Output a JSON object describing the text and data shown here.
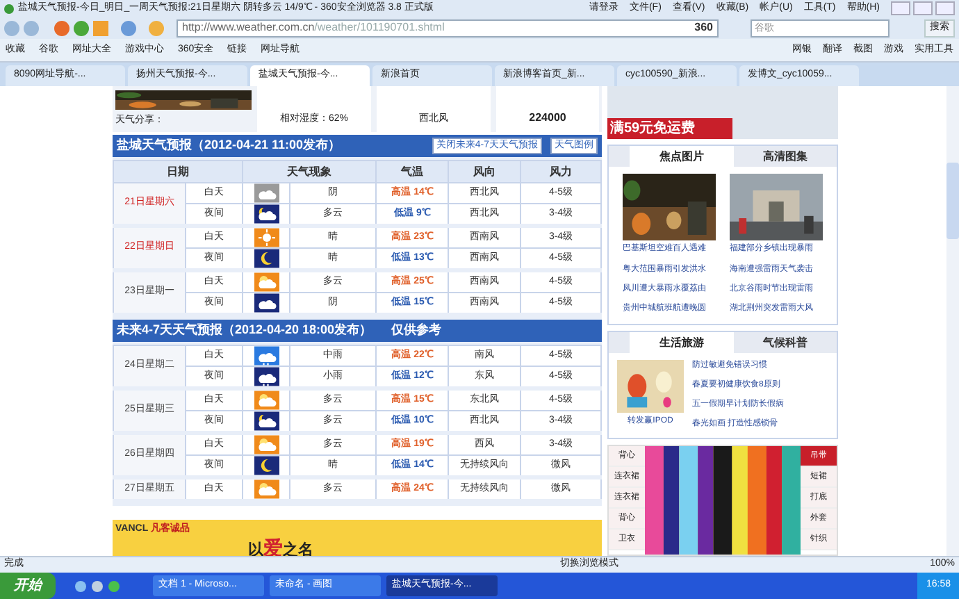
{
  "window": {
    "title": "盐城天气预报-今日_明日_一周天气预报:21日星期六 阴转多云 14/9℃ - 360安全浏览器 3.8 正式版"
  },
  "menu": [
    "请登录",
    "文件(F)",
    "查看(V)",
    "收藏(B)",
    "帐户(U)",
    "工具(T)",
    "帮助(H)"
  ],
  "address": {
    "host": "http://www.weather.com.cn",
    "path": "/weather/101190701.shtml"
  },
  "brand": "360",
  "search": {
    "placeholder": "谷歌",
    "button": "搜索"
  },
  "bookmarks": [
    "收藏",
    "谷歌",
    "网址大全",
    "游戏中心",
    "360安全",
    "链接",
    "网址导航"
  ],
  "tools": [
    "网银",
    "翻译",
    "截图",
    "游戏",
    "实用工具"
  ],
  "tabs": [
    {
      "label": "8090网址导航-...",
      "selected": false
    },
    {
      "label": "扬州天气预报-今...",
      "selected": false
    },
    {
      "label": "盐城天气预报-今...",
      "selected": true
    },
    {
      "label": "新浪首页",
      "selected": false
    },
    {
      "label": "新浪博客首页_新...",
      "selected": false
    },
    {
      "label": "cyc100590_新浪...",
      "selected": false
    },
    {
      "label": "发博文_cyc10059...",
      "selected": false
    }
  ],
  "top_strip": {
    "share": "天气分享：",
    "humidity": "相对湿度：62%",
    "wind": "西北风",
    "count": "224000"
  },
  "forecasts": [
    {
      "title": "盐城天气预报（2012-04-21 11:00发布）",
      "buttons": [
        "关闭未来4-7天天气预报",
        "天气图例"
      ],
      "columns": [
        "日期",
        "天气现象",
        "气温",
        "风向",
        "风力"
      ],
      "days": [
        {
          "date": "21日星期六",
          "weekend": true,
          "periods": [
            {
              "period": "白天",
              "kind": "overcast-day",
              "weather": "阴",
              "temp": {
                "kind": "high",
                "text": "高温 14℃"
              },
              "wind_dir": "西北风",
              "wind_force": "4-5级"
            },
            {
              "period": "夜间",
              "kind": "cloud-night",
              "weather": "多云",
              "temp": {
                "kind": "low",
                "text": "低温 9℃"
              },
              "wind_dir": "西北风",
              "wind_force": "3-4级"
            }
          ]
        },
        {
          "date": "22日星期日",
          "weekend": true,
          "periods": [
            {
              "period": "白天",
              "kind": "sun",
              "weather": "晴",
              "temp": {
                "kind": "high",
                "text": "高温 23℃"
              },
              "wind_dir": "西南风",
              "wind_force": "3-4级"
            },
            {
              "period": "夜间",
              "kind": "moon",
              "weather": "晴",
              "temp": {
                "kind": "low",
                "text": "低温 13℃"
              },
              "wind_dir": "西南风",
              "wind_force": "4-5级"
            }
          ]
        },
        {
          "date": "23日星期一",
          "weekend": false,
          "periods": [
            {
              "period": "白天",
              "kind": "cloud-day",
              "weather": "多云",
              "temp": {
                "kind": "high",
                "text": "高温 25℃"
              },
              "wind_dir": "西南风",
              "wind_force": "4-5级"
            },
            {
              "period": "夜间",
              "kind": "overcast-night",
              "weather": "阴",
              "temp": {
                "kind": "low",
                "text": "低温 15℃"
              },
              "wind_dir": "西南风",
              "wind_force": "4-5级"
            }
          ]
        }
      ]
    },
    {
      "title": "未来4-7天天气预报（2012-04-20 18:00发布）",
      "note": "仅供参考",
      "days": [
        {
          "date": "24日星期二",
          "weekend": false,
          "periods": [
            {
              "period": "白天",
              "kind": "rain-day",
              "weather": "中雨",
              "temp": {
                "kind": "high",
                "text": "高温 22℃"
              },
              "wind_dir": "南风",
              "wind_force": "4-5级"
            },
            {
              "period": "夜间",
              "kind": "rain-night",
              "weather": "小雨",
              "temp": {
                "kind": "low",
                "text": "低温 12℃"
              },
              "wind_dir": "东风",
              "wind_force": "4-5级"
            }
          ]
        },
        {
          "date": "25日星期三",
          "weekend": false,
          "periods": [
            {
              "period": "白天",
              "kind": "cloud-day",
              "weather": "多云",
              "temp": {
                "kind": "high",
                "text": "高温 15℃"
              },
              "wind_dir": "东北风",
              "wind_force": "4-5级"
            },
            {
              "period": "夜间",
              "kind": "cloud-night",
              "weather": "多云",
              "temp": {
                "kind": "low",
                "text": "低温 10℃"
              },
              "wind_dir": "西北风",
              "wind_force": "3-4级"
            }
          ]
        },
        {
          "date": "26日星期四",
          "weekend": false,
          "periods": [
            {
              "period": "白天",
              "kind": "cloud-day",
              "weather": "多云",
              "temp": {
                "kind": "high",
                "text": "高温 19℃"
              },
              "wind_dir": "西风",
              "wind_force": "3-4级"
            },
            {
              "period": "夜间",
              "kind": "moon",
              "weather": "晴",
              "temp": {
                "kind": "low",
                "text": "低温 14℃"
              },
              "wind_dir": "无持续风向",
              "wind_force": "微风"
            }
          ]
        },
        {
          "date": "27日星期五",
          "weekend": false,
          "periods": [
            {
              "period": "白天",
              "kind": "cloud-day",
              "weather": "多云",
              "temp": {
                "kind": "high",
                "text": "高温 24℃"
              },
              "wind_dir": "无持续风向",
              "wind_force": "微风"
            }
          ]
        }
      ]
    }
  ],
  "ad": {
    "brand": "VANCL",
    "tagline": "凡客诚品",
    "slogan_1": "以",
    "slogan_2": "爱",
    "slogan_3": "之名"
  },
  "right_ad": {
    "text": "满59元免运费"
  },
  "photo_box": {
    "tabs": [
      {
        "label": "焦点图片",
        "selected": true
      },
      {
        "label": "高清图集",
        "selected": false
      }
    ],
    "captions": [
      "巴基斯坦空难百人遇难",
      "福建部分乡镇出现暴雨"
    ],
    "links": [
      "粤大范围暴雨引发洪水",
      "海南遭强雷雨天气袭击",
      "凤川遭大暴雨水覆荔由",
      "北京谷雨时节出现雷雨",
      "贵州中城航班航遭晚圆",
      "湖北荆州突发雷雨大风"
    ]
  },
  "life_box": {
    "tabs": [
      {
        "label": "生活旅游",
        "selected": true
      },
      {
        "label": "气候科普",
        "selected": false
      }
    ],
    "caption": "转发赢IPOD",
    "links": [
      "防过敏避免错误习惯",
      "春夏要初健康饮食8原则",
      "五一假期早计划防长假病",
      "春光如画 打造性感锁骨"
    ]
  },
  "clothes": {
    "left": [
      "背心",
      "连衣裙",
      "连衣裙",
      "背心",
      "卫衣"
    ],
    "right": [
      {
        "label": "吊带",
        "selected": true
      },
      {
        "label": "短裙",
        "selected": false
      },
      {
        "label": "打底",
        "selected": false
      },
      {
        "label": "外套",
        "selected": false
      },
      {
        "label": "针织",
        "selected": false
      }
    ]
  },
  "status_bar": {
    "text": "完成",
    "mode": "切换浏览模式",
    "zoom": "100%"
  },
  "taskbar": {
    "start": "开始",
    "tasks": [
      {
        "label": "文档 1 - Microso...",
        "selected": false
      },
      {
        "label": "未命名 - 画图",
        "selected": false
      },
      {
        "label": "盐城天气预报-今...",
        "selected": true
      }
    ],
    "clock": "16:58"
  }
}
